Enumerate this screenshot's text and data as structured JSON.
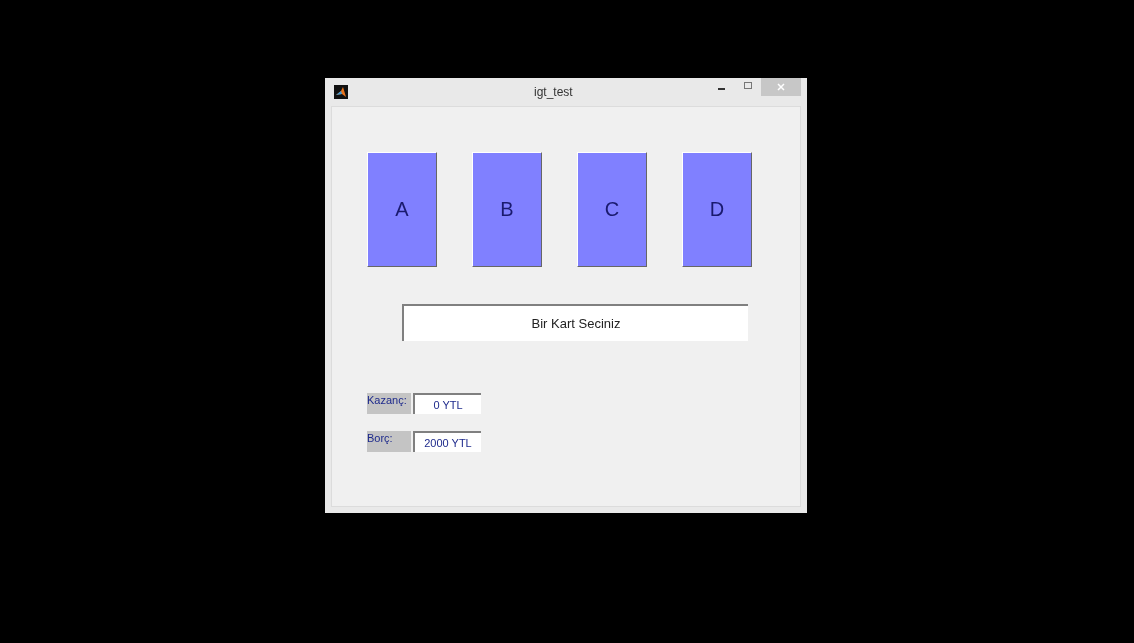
{
  "window": {
    "title": "igt_test"
  },
  "cards": [
    {
      "label": "A"
    },
    {
      "label": "B"
    },
    {
      "label": "C"
    },
    {
      "label": "D"
    }
  ],
  "message": "Bir Kart Seciniz",
  "stats": [
    {
      "label": "Kazanç:",
      "value": "0 YTL"
    },
    {
      "label": "Borç:",
      "value": "2000 YTL"
    }
  ]
}
